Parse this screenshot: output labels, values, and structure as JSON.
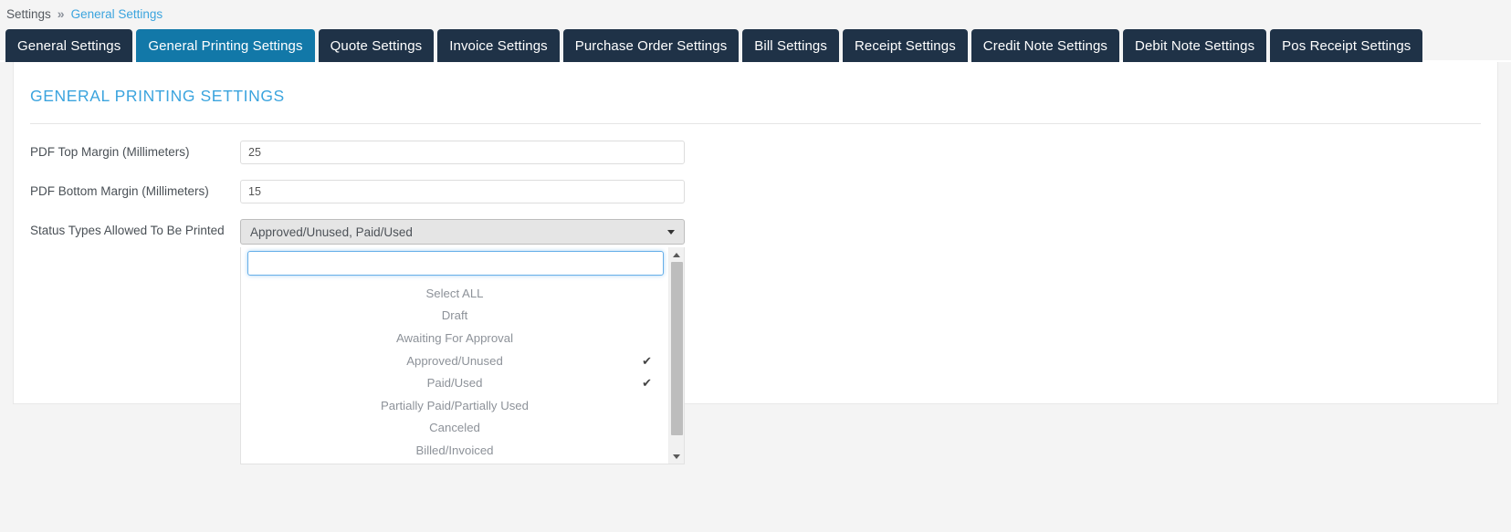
{
  "breadcrumb": {
    "root": "Settings",
    "separator": "»",
    "active": "General Settings"
  },
  "tabs": [
    {
      "label": "General Settings",
      "active": false
    },
    {
      "label": "General Printing Settings",
      "active": true
    },
    {
      "label": "Quote Settings",
      "active": false
    },
    {
      "label": "Invoice Settings",
      "active": false
    },
    {
      "label": "Purchase Order Settings",
      "active": false
    },
    {
      "label": "Bill Settings",
      "active": false
    },
    {
      "label": "Receipt Settings",
      "active": false
    },
    {
      "label": "Credit Note Settings",
      "active": false
    },
    {
      "label": "Debit Note Settings",
      "active": false
    },
    {
      "label": "Pos Receipt Settings",
      "active": false
    }
  ],
  "panel": {
    "title": "GENERAL PRINTING SETTINGS",
    "fields": {
      "top_margin": {
        "label": "PDF Top Margin (Millimeters)",
        "value": "25",
        "placeholder": ""
      },
      "bottom_margin": {
        "label": "PDF Bottom Margin (Millimeters)",
        "value": "15",
        "placeholder": ""
      },
      "status_types": {
        "label": "Status Types Allowed To Be Printed",
        "selected_text": "Approved/Unused, Paid/Used",
        "search_value": "",
        "search_placeholder": "",
        "options": [
          {
            "label": "Select ALL",
            "checked": false
          },
          {
            "label": "Draft",
            "checked": false
          },
          {
            "label": "Awaiting For Approval",
            "checked": false
          },
          {
            "label": "Approved/Unused",
            "checked": true
          },
          {
            "label": "Paid/Used",
            "checked": true
          },
          {
            "label": "Partially Paid/Partially Used",
            "checked": false
          },
          {
            "label": "Canceled",
            "checked": false
          },
          {
            "label": "Billed/Invoiced",
            "checked": false
          }
        ],
        "check_glyph": "✔",
        "caret_glyph": "▾"
      }
    }
  },
  "colors": {
    "tab_inactive_bg": "#1f3247",
    "tab_active_bg": "#1278a8",
    "title_blue": "#3ba4de",
    "link_blue": "#3ba4de",
    "page_bg": "#f4f4f4"
  }
}
